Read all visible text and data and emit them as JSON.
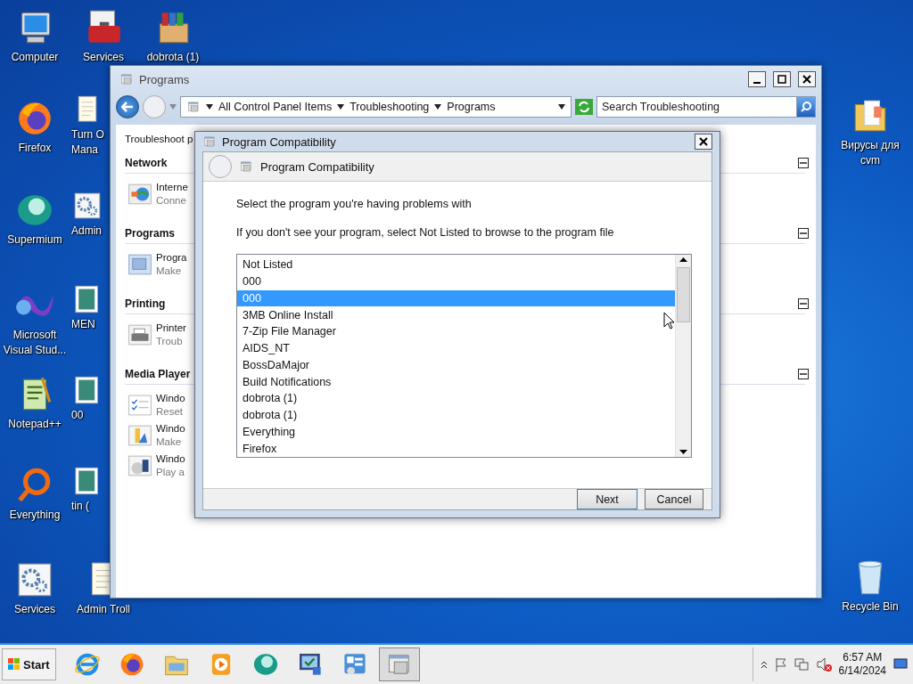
{
  "desktop_icons": [
    {
      "kind": "computer",
      "lines": [
        "Computer"
      ]
    },
    {
      "kind": "firefox",
      "lines": [
        "Firefox"
      ]
    },
    {
      "kind": "supermium",
      "lines": [
        "Supermium"
      ]
    },
    {
      "kind": "vs",
      "lines": [
        "Microsoft",
        "Visual Stud..."
      ]
    },
    {
      "kind": "notepad",
      "lines": [
        "Notepad++"
      ]
    },
    {
      "kind": "everything",
      "lines": [
        "Everything"
      ]
    },
    {
      "kind": "gear",
      "lines": [
        "Services"
      ]
    },
    {
      "kind": "toolbox",
      "lines": [
        "Services"
      ]
    },
    {
      "kind": "document",
      "lines": [
        "Turn O",
        "Mana"
      ]
    },
    {
      "kind": "gear",
      "lines": [
        "Admin"
      ]
    },
    {
      "kind": "picture",
      "lines": [
        "MEN"
      ]
    },
    {
      "kind": "picture",
      "lines": [
        "00"
      ]
    },
    {
      "kind": "picture",
      "lines": [
        "tin ("
      ]
    },
    {
      "kind": "document",
      "lines": [
        "Admin Troll"
      ]
    },
    {
      "kind": "package",
      "lines": [
        "dobrota (1)"
      ]
    },
    {
      "kind": "folder",
      "lines": [
        "Вирусы для",
        "cvm"
      ]
    },
    {
      "kind": "recycle",
      "lines": [
        "Recycle Bin"
      ]
    }
  ],
  "explorer": {
    "title": "Programs",
    "breadcrumb": [
      "All Control Panel Items",
      "Troubleshooting",
      "Programs"
    ],
    "search": {
      "placeholder": "Search Troubleshooting"
    },
    "heading": "Troubleshoot p",
    "groups": [
      {
        "title": "Network",
        "expanded": true,
        "items": [
          {
            "kind": "network",
            "title": "Interne",
            "subtitle": "Conne"
          }
        ]
      },
      {
        "title": "Programs",
        "expanded": true,
        "items": [
          {
            "kind": "programs",
            "title": "Progra",
            "subtitle": "Make"
          }
        ]
      },
      {
        "title": "Printing",
        "expanded": true,
        "items": [
          {
            "kind": "printer",
            "title": "Printer",
            "subtitle": "Troub"
          }
        ]
      },
      {
        "title": "Media Player",
        "expanded": true,
        "items": [
          {
            "kind": "checklist",
            "title": "Windo",
            "subtitle": "Reset"
          },
          {
            "kind": "library",
            "title": "Windo",
            "subtitle": "Make"
          },
          {
            "kind": "dvd",
            "title": "Windo",
            "subtitle": "Play a"
          }
        ]
      }
    ]
  },
  "dialog": {
    "title": "Program Compatibility",
    "header": "Program Compatibility",
    "prompt": "Select the program you're having problems with",
    "hint": "If you don't see your program, select Not Listed to browse to the program file",
    "programs": [
      {
        "name": "Not Listed",
        "selected": false
      },
      {
        "name": "000",
        "selected": false
      },
      {
        "name": "000",
        "selected": true
      },
      {
        "name": "3MB Online Install",
        "selected": false
      },
      {
        "name": "7-Zip File Manager",
        "selected": false
      },
      {
        "name": "AIDS_NT",
        "selected": false
      },
      {
        "name": "BossDaMajor",
        "selected": false
      },
      {
        "name": "Build Notifications",
        "selected": false
      },
      {
        "name": "dobrota (1)",
        "selected": false
      },
      {
        "name": "dobrota (1)",
        "selected": false
      },
      {
        "name": "Everything",
        "selected": false
      },
      {
        "name": "Firefox",
        "selected": false
      }
    ],
    "buttons": [
      "Next",
      "Cancel"
    ]
  },
  "taskbar": {
    "start": "Start",
    "apps": [
      {
        "kind": "ie",
        "active": false
      },
      {
        "kind": "firefox",
        "active": false
      },
      {
        "kind": "explorer",
        "active": false
      },
      {
        "kind": "media",
        "active": false
      },
      {
        "kind": "supermium",
        "active": false
      },
      {
        "kind": "monitor",
        "active": false
      },
      {
        "kind": "control",
        "active": false
      },
      {
        "kind": "window",
        "active": true
      }
    ],
    "time": "6:57 AM",
    "date": "6/14/2024"
  }
}
